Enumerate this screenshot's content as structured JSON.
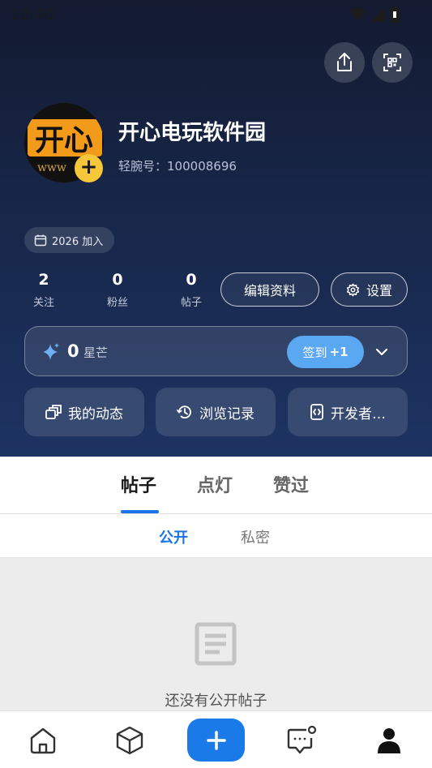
{
  "status": {
    "time": "10:40"
  },
  "profile": {
    "name": "开心电玩软件园",
    "id_label": "轻腕号：",
    "id_value": "100008696",
    "join_text": "2026 加入",
    "avatar_text": "开心",
    "avatar_sub": "www"
  },
  "stats": [
    {
      "value": "2",
      "label": "关注"
    },
    {
      "value": "0",
      "label": "粉丝"
    },
    {
      "value": "0",
      "label": "帖子"
    }
  ],
  "actions": {
    "edit_profile": "编辑资料",
    "settings": "设置"
  },
  "stars": {
    "count": "0",
    "label": "星芒",
    "signin_label": "签到",
    "signin_bonus": "+1"
  },
  "quick_links": [
    {
      "label": "我的动态",
      "icon": "feed-icon"
    },
    {
      "label": "浏览记录",
      "icon": "history-icon"
    },
    {
      "label": "开发者…",
      "icon": "developer-icon"
    }
  ],
  "tabs": [
    {
      "label": "帖子"
    },
    {
      "label": "点灯"
    },
    {
      "label": "赞过"
    }
  ],
  "subtabs": [
    {
      "label": "公开"
    },
    {
      "label": "私密"
    }
  ],
  "empty_state": {
    "text": "还没有公开帖子"
  },
  "colors": {
    "accent": "#1a7ae8",
    "signin": "#5aa7f2",
    "badge": "#f6c73a"
  }
}
